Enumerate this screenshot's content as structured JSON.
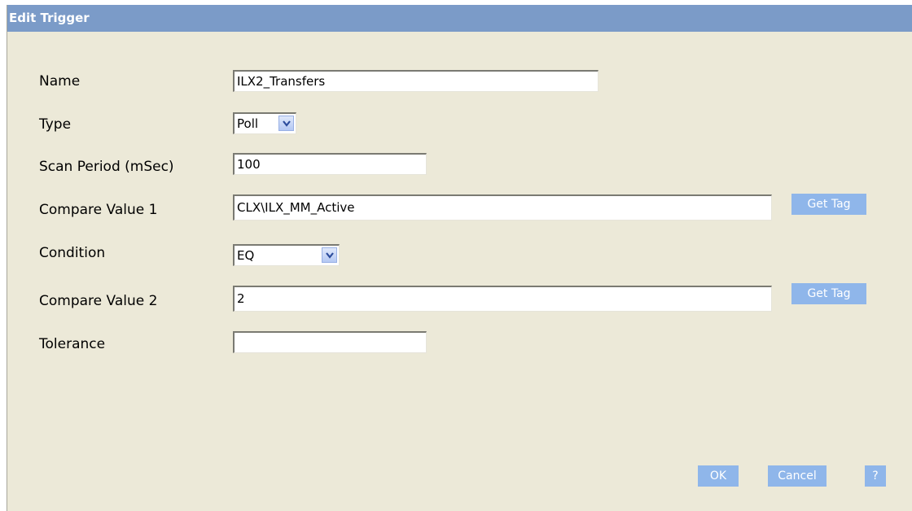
{
  "dialog": {
    "title": "Edit Trigger"
  },
  "form": {
    "name_label": "Name",
    "name_value": "ILX2_Transfers",
    "type_label": "Type",
    "type_value": "Poll",
    "scan_period_label": "Scan Period (mSec)",
    "scan_period_value": "100",
    "compare_value_1_label": "Compare Value 1",
    "compare_value_1_value": "CLX\\ILX_MM_Active",
    "condition_label": "Condition",
    "condition_value": "EQ",
    "compare_value_2_label": "Compare Value 2",
    "compare_value_2_value": "2",
    "tolerance_label": "Tolerance",
    "tolerance_value": ""
  },
  "buttons": {
    "get_tag_1": "Get Tag",
    "get_tag_2": "Get Tag",
    "ok": "OK",
    "cancel": "Cancel",
    "help": "?"
  },
  "colors": {
    "titlebar": "#7b9bc8",
    "background": "#ece9d8",
    "button": "#8fb6ea"
  }
}
